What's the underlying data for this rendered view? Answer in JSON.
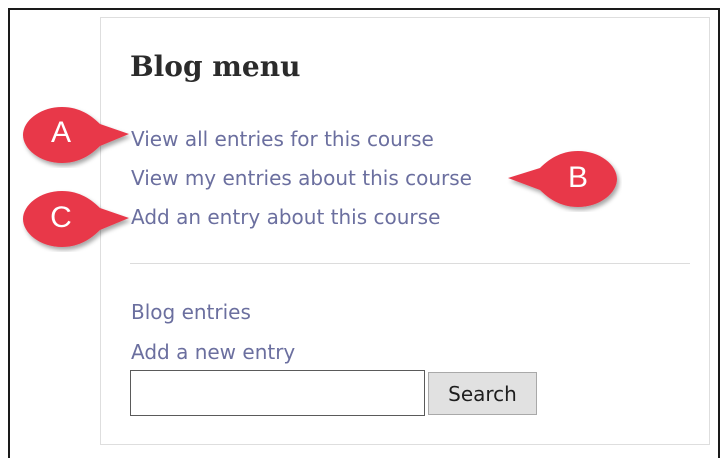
{
  "block": {
    "title": "Blog menu",
    "links": {
      "view_all": "View all entries for this course",
      "view_mine": "View my entries about this course",
      "add_entry": "Add an entry about this course",
      "blog_entries": "Blog entries",
      "add_new": "Add a new entry"
    },
    "search": {
      "value": "",
      "button_label": "Search"
    }
  },
  "callouts": {
    "a": "A",
    "b": "B",
    "c": "C"
  },
  "colors": {
    "link": "#6b6f9f",
    "callout": "#e8374a",
    "title": "#2b2b2b"
  }
}
